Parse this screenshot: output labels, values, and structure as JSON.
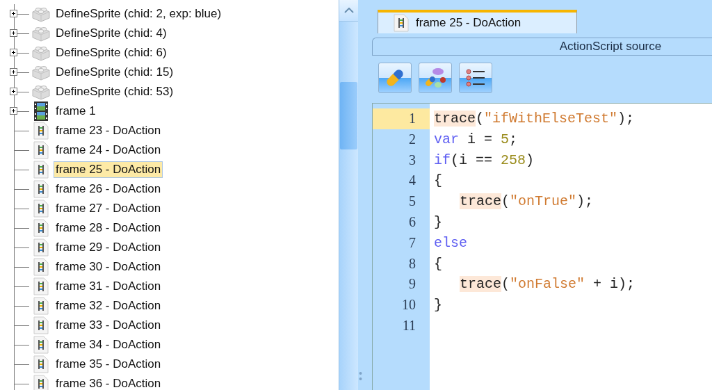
{
  "tree": {
    "items": [
      {
        "kind": "sprite",
        "label": "DefineSprite (chid: 2, exp: blue)",
        "expandable": true,
        "selected": false
      },
      {
        "kind": "sprite",
        "label": "DefineSprite (chid: 4)",
        "expandable": true,
        "selected": false
      },
      {
        "kind": "sprite",
        "label": "DefineSprite (chid: 6)",
        "expandable": true,
        "selected": false
      },
      {
        "kind": "sprite",
        "label": "DefineSprite (chid: 15)",
        "expandable": true,
        "selected": false
      },
      {
        "kind": "sprite",
        "label": "DefineSprite (chid: 53)",
        "expandable": true,
        "selected": false
      },
      {
        "kind": "frame",
        "label": "frame 1",
        "expandable": true,
        "selected": false
      },
      {
        "kind": "action",
        "label": "frame 23 - DoAction",
        "expandable": false,
        "selected": false
      },
      {
        "kind": "action",
        "label": "frame 24 - DoAction",
        "expandable": false,
        "selected": false
      },
      {
        "kind": "action",
        "label": "frame 25 - DoAction",
        "expandable": false,
        "selected": true
      },
      {
        "kind": "action",
        "label": "frame 26 - DoAction",
        "expandable": false,
        "selected": false
      },
      {
        "kind": "action",
        "label": "frame 27 - DoAction",
        "expandable": false,
        "selected": false
      },
      {
        "kind": "action",
        "label": "frame 28 - DoAction",
        "expandable": false,
        "selected": false
      },
      {
        "kind": "action",
        "label": "frame 29 - DoAction",
        "expandable": false,
        "selected": false
      },
      {
        "kind": "action",
        "label": "frame 30 - DoAction",
        "expandable": false,
        "selected": false
      },
      {
        "kind": "action",
        "label": "frame 31 - DoAction",
        "expandable": false,
        "selected": false
      },
      {
        "kind": "action",
        "label": "frame 32 - DoAction",
        "expandable": false,
        "selected": false
      },
      {
        "kind": "action",
        "label": "frame 33 - DoAction",
        "expandable": false,
        "selected": false
      },
      {
        "kind": "action",
        "label": "frame 34 - DoAction",
        "expandable": false,
        "selected": false
      },
      {
        "kind": "action",
        "label": "frame 35 - DoAction",
        "expandable": false,
        "selected": false
      },
      {
        "kind": "action",
        "label": "frame 36 - DoAction",
        "expandable": false,
        "selected": false
      }
    ]
  },
  "document_tab": {
    "label": "frame 25 - DoAction",
    "selected": true
  },
  "panel_header": {
    "title": "ActionScript source"
  },
  "toolbar": [
    {
      "kind": "pill"
    },
    {
      "kind": "pills"
    },
    {
      "kind": "list"
    }
  ],
  "editor": {
    "lines": [
      {
        "number": "1",
        "current": true,
        "indented": false,
        "tokens": [
          {
            "kind": "function",
            "text": "trace"
          },
          {
            "kind": "plain",
            "text": "("
          },
          {
            "kind": "string",
            "text": "\"ifWithElseTest\""
          },
          {
            "kind": "plain",
            "text": ");"
          }
        ]
      },
      {
        "number": "2",
        "current": false,
        "indented": false,
        "tokens": [
          {
            "kind": "keyword",
            "text": "var"
          },
          {
            "kind": "plain",
            "text": " i = "
          },
          {
            "kind": "number",
            "text": "5"
          },
          {
            "kind": "plain",
            "text": ";"
          }
        ]
      },
      {
        "number": "3",
        "current": false,
        "indented": false,
        "tokens": [
          {
            "kind": "keyword",
            "text": "if"
          },
          {
            "kind": "plain",
            "text": "(i == "
          },
          {
            "kind": "number",
            "text": "258"
          },
          {
            "kind": "plain",
            "text": ")"
          }
        ]
      },
      {
        "number": "4",
        "current": false,
        "indented": false,
        "tokens": [
          {
            "kind": "plain",
            "text": "{"
          }
        ]
      },
      {
        "number": "5",
        "current": false,
        "indented": true,
        "tokens": [
          {
            "kind": "function",
            "text": "trace"
          },
          {
            "kind": "plain",
            "text": "("
          },
          {
            "kind": "string",
            "text": "\"onTrue\""
          },
          {
            "kind": "plain",
            "text": ");"
          }
        ]
      },
      {
        "number": "6",
        "current": false,
        "indented": false,
        "tokens": [
          {
            "kind": "plain",
            "text": "}"
          }
        ]
      },
      {
        "number": "7",
        "current": false,
        "indented": false,
        "tokens": [
          {
            "kind": "keyword",
            "text": "else"
          }
        ]
      },
      {
        "number": "8",
        "current": false,
        "indented": false,
        "tokens": [
          {
            "kind": "plain",
            "text": "{"
          }
        ]
      },
      {
        "number": "9",
        "current": false,
        "indented": true,
        "tokens": [
          {
            "kind": "function",
            "text": "trace"
          },
          {
            "kind": "plain",
            "text": "("
          },
          {
            "kind": "string",
            "text": "\"onFalse\""
          },
          {
            "kind": "plain",
            "text": " + i);"
          }
        ]
      },
      {
        "number": "10",
        "current": false,
        "indented": false,
        "tokens": [
          {
            "kind": "plain",
            "text": "}"
          }
        ]
      },
      {
        "number": "11",
        "current": false,
        "indented": false
      }
    ]
  }
}
